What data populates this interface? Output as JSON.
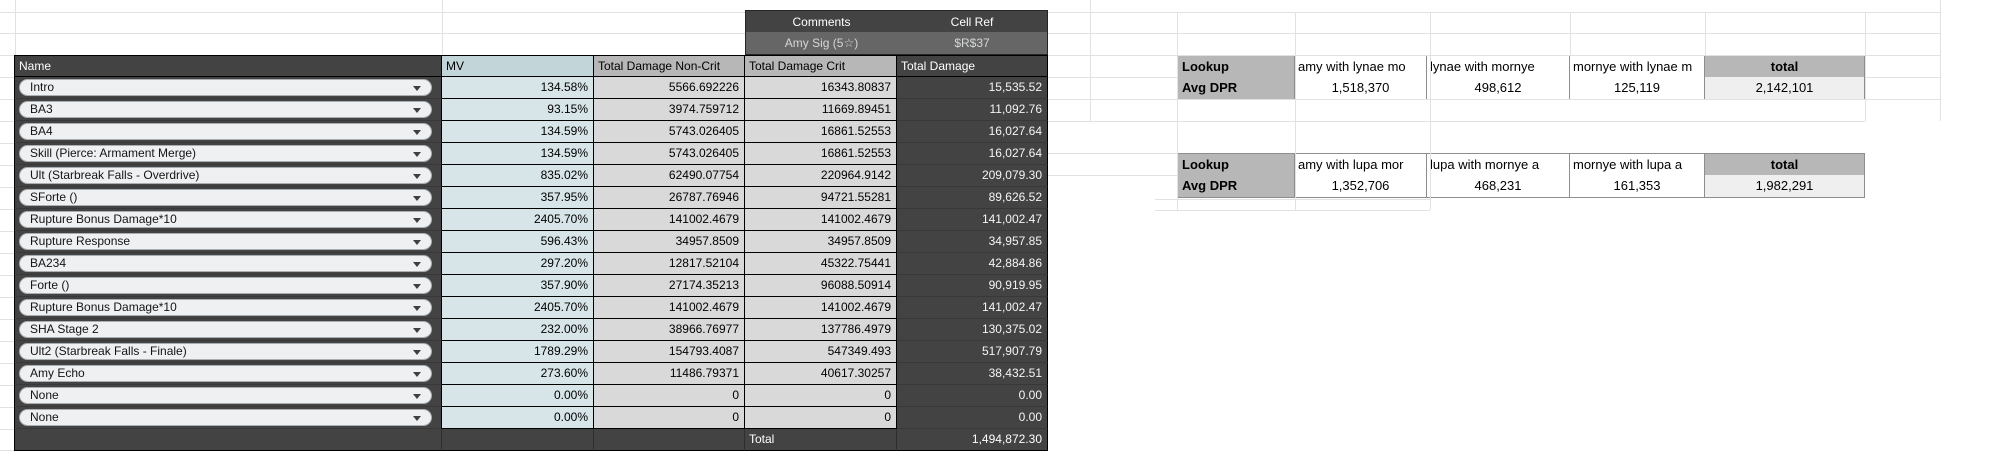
{
  "sheet": {
    "comments_header": "Comments",
    "comments_value": "Amy Sig (5☆)",
    "cellref_header": "Cell Ref",
    "cellref_value": "$R$37",
    "columns": [
      "Name",
      "MV",
      "Total Damage Non-Crit",
      "Total Damage Crit",
      "Total Damage"
    ],
    "rows": [
      {
        "name": "Intro",
        "mv": "134.58%",
        "noncrit": "5566.692226",
        "crit": "16343.80837",
        "total": "15,535.52"
      },
      {
        "name": "BA3",
        "mv": "93.15%",
        "noncrit": "3974.759712",
        "crit": "11669.89451",
        "total": "11,092.76"
      },
      {
        "name": "BA4",
        "mv": "134.59%",
        "noncrit": "5743.026405",
        "crit": "16861.52553",
        "total": "16,027.64"
      },
      {
        "name": "Skill (Pierce: Armament Merge)",
        "mv": "134.59%",
        "noncrit": "5743.026405",
        "crit": "16861.52553",
        "total": "16,027.64"
      },
      {
        "name": "Ult (Starbreak Falls - Overdrive)",
        "mv": "835.02%",
        "noncrit": "62490.07754",
        "crit": "220964.9142",
        "total": "209,079.30"
      },
      {
        "name": "SForte ()",
        "mv": "357.95%",
        "noncrit": "26787.76946",
        "crit": "94721.55281",
        "total": "89,626.52"
      },
      {
        "name": "Rupture Bonus Damage*10",
        "mv": "2405.70%",
        "noncrit": "141002.4679",
        "crit": "141002.4679",
        "total": "141,002.47"
      },
      {
        "name": "Rupture Response",
        "mv": "596.43%",
        "noncrit": "34957.8509",
        "crit": "34957.8509",
        "total": "34,957.85"
      },
      {
        "name": "BA234",
        "mv": "297.20%",
        "noncrit": "12817.52104",
        "crit": "45322.75441",
        "total": "42,884.86"
      },
      {
        "name": "Forte ()",
        "mv": "357.90%",
        "noncrit": "27174.35213",
        "crit": "96088.50914",
        "total": "90,919.95"
      },
      {
        "name": "Rupture Bonus Damage*10",
        "mv": "2405.70%",
        "noncrit": "141002.4679",
        "crit": "141002.4679",
        "total": "141,002.47"
      },
      {
        "name": "SHA Stage 2",
        "mv": "232.00%",
        "noncrit": "38966.76977",
        "crit": "137786.4979",
        "total": "130,375.02"
      },
      {
        "name": "Ult2 (Starbreak Falls - Finale)",
        "mv": "1789.29%",
        "noncrit": "154793.4087",
        "crit": "547349.493",
        "total": "517,907.79"
      },
      {
        "name": "Amy Echo",
        "mv": "273.60%",
        "noncrit": "11486.79371",
        "crit": "40617.30257",
        "total": "38,432.51"
      },
      {
        "name": "None",
        "mv": "0.00%",
        "noncrit": "0",
        "crit": "0",
        "total": "0.00"
      },
      {
        "name": "None",
        "mv": "0.00%",
        "noncrit": "0",
        "crit": "0",
        "total": "0.00"
      }
    ],
    "total_label": "Total",
    "total_value": "1,494,872.30",
    "icons": {
      "dropdown_arrow": "▼"
    }
  },
  "lookup_tables": [
    {
      "header_row": [
        "Lookup",
        "amy with lynae mo",
        "lynae with mornye",
        "mornye with lynae m",
        "total"
      ],
      "data_row": [
        "Avg DPR",
        "1,518,370",
        "498,612",
        "125,119",
        "2,142,101"
      ]
    },
    {
      "header_row": [
        "Lookup",
        "amy with lupa mor",
        "lupa with mornye a",
        "mornye with lupa a",
        "total"
      ],
      "data_row": [
        "Avg DPR",
        "1,352,706",
        "468,231",
        "161,353",
        "1,982,291"
      ]
    }
  ],
  "colors": {
    "dark_header": "#434343",
    "mid_header": "#666666",
    "mv_header": "#c2d6da",
    "mv_cell": "#d7e4e8",
    "gray_header": "#b7b7b7",
    "gray_cell": "#d9d9d9",
    "lookup_header": "#b7b7b7",
    "total_value_cell": "#efefef",
    "gridline": "#e2e2e2"
  }
}
